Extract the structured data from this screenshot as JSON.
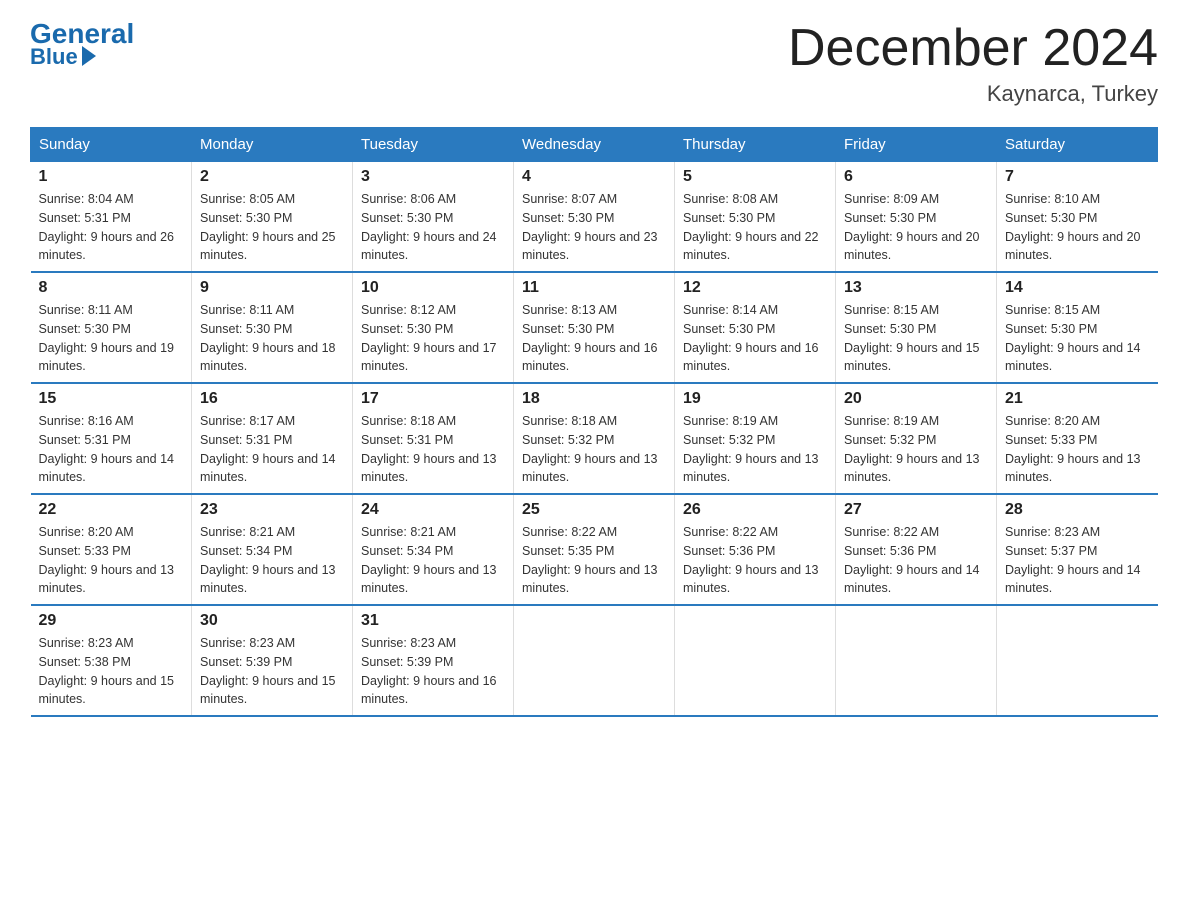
{
  "logo": {
    "general": "General",
    "blue_text": "Blue",
    "arrow": true
  },
  "title": "December 2024",
  "location": "Kaynarca, Turkey",
  "days_of_week": [
    "Sunday",
    "Monday",
    "Tuesday",
    "Wednesday",
    "Thursday",
    "Friday",
    "Saturday"
  ],
  "weeks": [
    [
      {
        "day": "1",
        "sunrise": "8:04 AM",
        "sunset": "5:31 PM",
        "daylight": "9 hours and 26 minutes."
      },
      {
        "day": "2",
        "sunrise": "8:05 AM",
        "sunset": "5:30 PM",
        "daylight": "9 hours and 25 minutes."
      },
      {
        "day": "3",
        "sunrise": "8:06 AM",
        "sunset": "5:30 PM",
        "daylight": "9 hours and 24 minutes."
      },
      {
        "day": "4",
        "sunrise": "8:07 AM",
        "sunset": "5:30 PM",
        "daylight": "9 hours and 23 minutes."
      },
      {
        "day": "5",
        "sunrise": "8:08 AM",
        "sunset": "5:30 PM",
        "daylight": "9 hours and 22 minutes."
      },
      {
        "day": "6",
        "sunrise": "8:09 AM",
        "sunset": "5:30 PM",
        "daylight": "9 hours and 20 minutes."
      },
      {
        "day": "7",
        "sunrise": "8:10 AM",
        "sunset": "5:30 PM",
        "daylight": "9 hours and 20 minutes."
      }
    ],
    [
      {
        "day": "8",
        "sunrise": "8:11 AM",
        "sunset": "5:30 PM",
        "daylight": "9 hours and 19 minutes."
      },
      {
        "day": "9",
        "sunrise": "8:11 AM",
        "sunset": "5:30 PM",
        "daylight": "9 hours and 18 minutes."
      },
      {
        "day": "10",
        "sunrise": "8:12 AM",
        "sunset": "5:30 PM",
        "daylight": "9 hours and 17 minutes."
      },
      {
        "day": "11",
        "sunrise": "8:13 AM",
        "sunset": "5:30 PM",
        "daylight": "9 hours and 16 minutes."
      },
      {
        "day": "12",
        "sunrise": "8:14 AM",
        "sunset": "5:30 PM",
        "daylight": "9 hours and 16 minutes."
      },
      {
        "day": "13",
        "sunrise": "8:15 AM",
        "sunset": "5:30 PM",
        "daylight": "9 hours and 15 minutes."
      },
      {
        "day": "14",
        "sunrise": "8:15 AM",
        "sunset": "5:30 PM",
        "daylight": "9 hours and 14 minutes."
      }
    ],
    [
      {
        "day": "15",
        "sunrise": "8:16 AM",
        "sunset": "5:31 PM",
        "daylight": "9 hours and 14 minutes."
      },
      {
        "day": "16",
        "sunrise": "8:17 AM",
        "sunset": "5:31 PM",
        "daylight": "9 hours and 14 minutes."
      },
      {
        "day": "17",
        "sunrise": "8:18 AM",
        "sunset": "5:31 PM",
        "daylight": "9 hours and 13 minutes."
      },
      {
        "day": "18",
        "sunrise": "8:18 AM",
        "sunset": "5:32 PM",
        "daylight": "9 hours and 13 minutes."
      },
      {
        "day": "19",
        "sunrise": "8:19 AM",
        "sunset": "5:32 PM",
        "daylight": "9 hours and 13 minutes."
      },
      {
        "day": "20",
        "sunrise": "8:19 AM",
        "sunset": "5:32 PM",
        "daylight": "9 hours and 13 minutes."
      },
      {
        "day": "21",
        "sunrise": "8:20 AM",
        "sunset": "5:33 PM",
        "daylight": "9 hours and 13 minutes."
      }
    ],
    [
      {
        "day": "22",
        "sunrise": "8:20 AM",
        "sunset": "5:33 PM",
        "daylight": "9 hours and 13 minutes."
      },
      {
        "day": "23",
        "sunrise": "8:21 AM",
        "sunset": "5:34 PM",
        "daylight": "9 hours and 13 minutes."
      },
      {
        "day": "24",
        "sunrise": "8:21 AM",
        "sunset": "5:34 PM",
        "daylight": "9 hours and 13 minutes."
      },
      {
        "day": "25",
        "sunrise": "8:22 AM",
        "sunset": "5:35 PM",
        "daylight": "9 hours and 13 minutes."
      },
      {
        "day": "26",
        "sunrise": "8:22 AM",
        "sunset": "5:36 PM",
        "daylight": "9 hours and 13 minutes."
      },
      {
        "day": "27",
        "sunrise": "8:22 AM",
        "sunset": "5:36 PM",
        "daylight": "9 hours and 14 minutes."
      },
      {
        "day": "28",
        "sunrise": "8:23 AM",
        "sunset": "5:37 PM",
        "daylight": "9 hours and 14 minutes."
      }
    ],
    [
      {
        "day": "29",
        "sunrise": "8:23 AM",
        "sunset": "5:38 PM",
        "daylight": "9 hours and 15 minutes."
      },
      {
        "day": "30",
        "sunrise": "8:23 AM",
        "sunset": "5:39 PM",
        "daylight": "9 hours and 15 minutes."
      },
      {
        "day": "31",
        "sunrise": "8:23 AM",
        "sunset": "5:39 PM",
        "daylight": "9 hours and 16 minutes."
      },
      null,
      null,
      null,
      null
    ]
  ]
}
